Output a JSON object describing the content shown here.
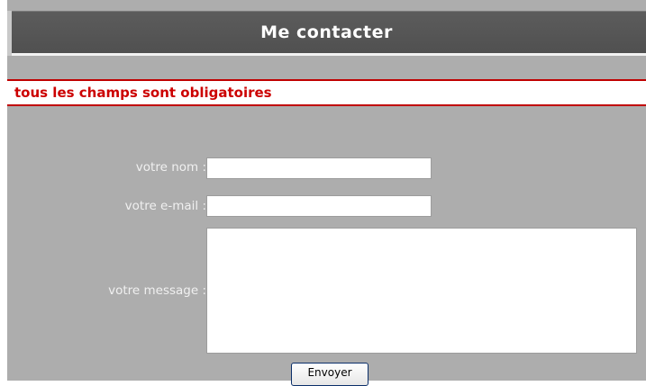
{
  "header": {
    "title": "Me contacter"
  },
  "notice": {
    "text": "tous les champs sont obligatoires"
  },
  "form": {
    "name_label": "votre nom :",
    "name_value": "",
    "email_label": "votre e-mail :",
    "email_value": "",
    "message_label": "votre message :",
    "message_value": "",
    "submit_label": "Envoyer"
  },
  "colors": {
    "panel_background": "#adadad",
    "header_background": "#555555",
    "notice_red": "#cc0000"
  }
}
